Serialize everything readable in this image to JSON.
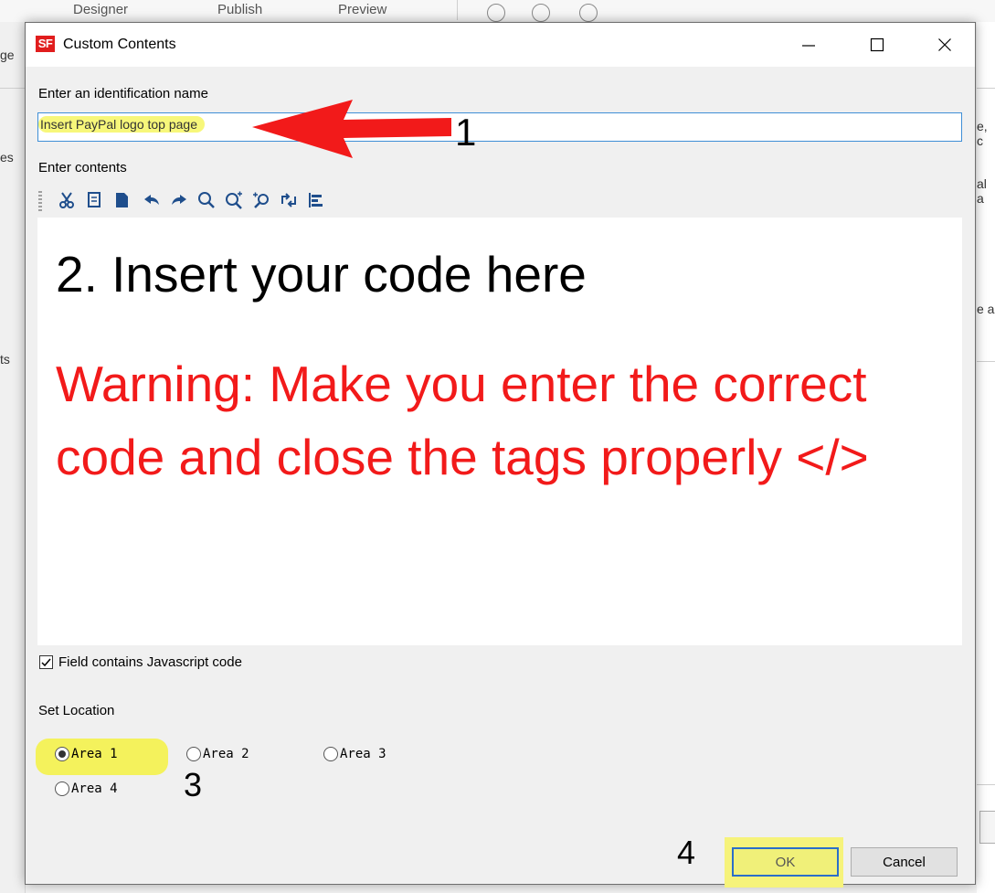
{
  "background": {
    "toolbar_items": [
      "Designer",
      "Publish",
      "Preview"
    ],
    "left_fragments": [
      "ge",
      "es",
      "ts"
    ],
    "right_fragments": [
      "e, c",
      "al a",
      "e a"
    ]
  },
  "dialog": {
    "app_icon": "SF",
    "title": "Custom Contents",
    "window_controls": {
      "minimize": "minimize-icon",
      "maximize": "maximize-icon",
      "close": "close-icon"
    },
    "name_label": "Enter an identification name",
    "name_value": "Insert PayPal logo top page",
    "contents_label": "Enter contents",
    "toolbar_icons": [
      "cut-icon",
      "copy-icon",
      "paste-icon",
      "undo-icon",
      "redo-icon",
      "search-icon",
      "zoom-in-icon",
      "replace-icon",
      "wrap-icon",
      "align-icon"
    ],
    "editor_line1": "2. Insert your code here",
    "editor_warning": "Warning: Make you enter the correct code and close the tags properly </>",
    "javascript_checkbox": {
      "label": "Field contains Javascript code",
      "checked": true
    },
    "location_label": "Set Location",
    "locations": [
      {
        "label": "Area 1",
        "checked": true
      },
      {
        "label": "Area 2",
        "checked": false
      },
      {
        "label": "Area 3",
        "checked": false
      },
      {
        "label": "Area 4",
        "checked": false
      }
    ],
    "ok_label": "OK",
    "cancel_label": "Cancel"
  },
  "annotations": {
    "step1": "1",
    "step3": "3",
    "step4": "4",
    "arrow_color": "#f21a1a",
    "highlight_color": "#f4f25c"
  }
}
